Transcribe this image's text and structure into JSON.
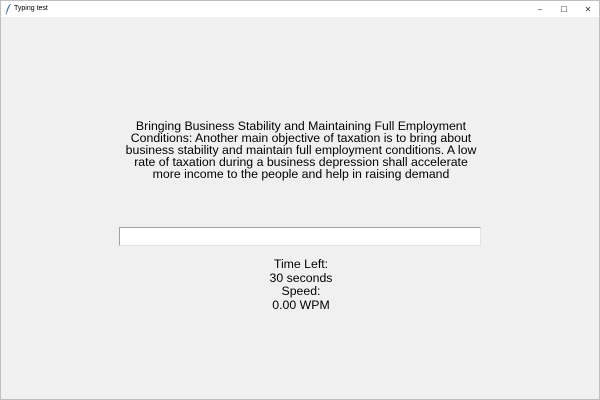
{
  "window": {
    "title": "Typing test",
    "icon": "feather-icon",
    "controls": {
      "minimize": "–",
      "maximize": "☐",
      "close": "✕"
    }
  },
  "test": {
    "passage": "Bringing Business Stability and Maintaining Full Employment Conditions: Another main objective of taxation is to bring about business stability and maintain full employment conditions. A low rate of taxation during a business depression shall accelerate more income to the people and help in raising demand",
    "input_value": ""
  },
  "stats": {
    "time_label": "Time Left:",
    "time_value": "30 seconds",
    "speed_label": "Speed:",
    "speed_value": "0.00 WPM"
  }
}
